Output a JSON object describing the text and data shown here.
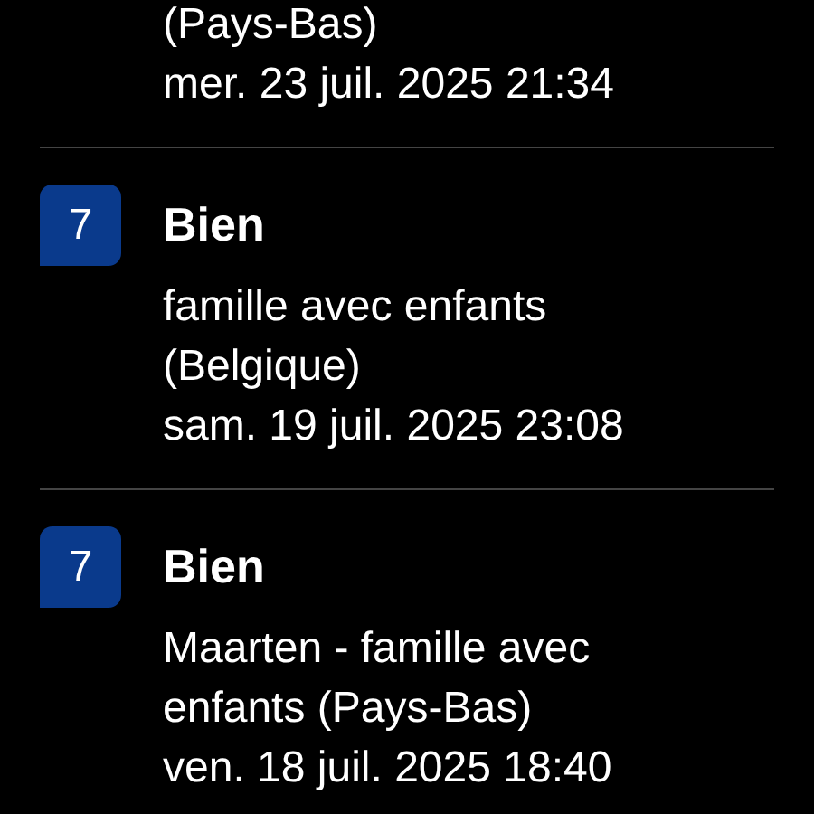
{
  "reviews": [
    {
      "description": "(Pays-Bas)",
      "date": "mer. 23 juil. 2025 21:34"
    },
    {
      "score": "7",
      "rating": "Bien",
      "description": "famille avec enfants (Belgique)",
      "date": "sam. 19 juil. 2025 23:08"
    },
    {
      "score": "7",
      "rating": "Bien",
      "description": "Maarten - famille avec enfants (Pays-Bas)",
      "date": "ven. 18 juil. 2025 18:40"
    }
  ]
}
